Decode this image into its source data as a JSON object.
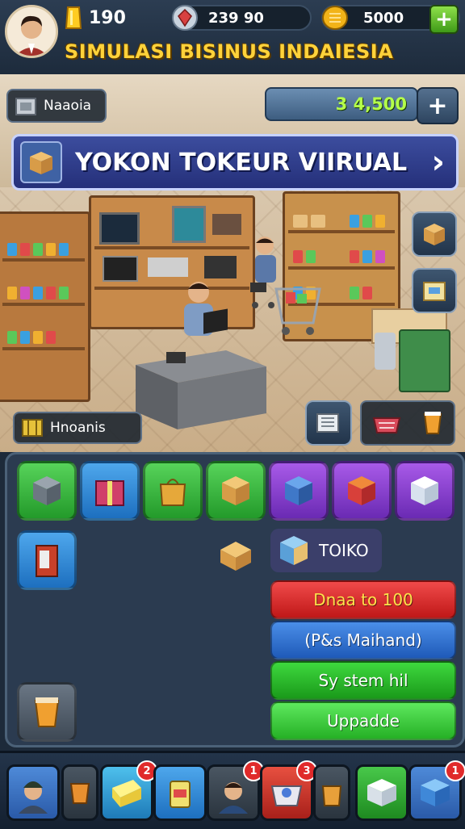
{
  "header": {
    "energy": "190",
    "gems": "239 90",
    "coins": "5000",
    "add_label": "+",
    "title": "SIMULASI BISINUS INDAIESIA"
  },
  "scene": {
    "location_label": "Naaoia",
    "balance": "3 4,500",
    "add_label": "+",
    "banner_title": "YOKON TOKEUR VIIRUAL",
    "banner_arrow": "›",
    "storage_label": "Hnoanis"
  },
  "panel": {
    "shop_name": "TOIKO",
    "buttons": [
      {
        "label": "Dnaa to 100",
        "color": "#e52a2a"
      },
      {
        "label": "(P&s Maihand)",
        "color": "#2a73d6"
      },
      {
        "label": "Sy stem hil",
        "color": "#27b52a"
      },
      {
        "label": "Uppadde",
        "color": "#33c43a"
      }
    ]
  },
  "bottombar": {
    "badges": [
      "2",
      "1",
      "3",
      "1"
    ]
  },
  "colors": {
    "gold": "#ffd23a",
    "green_accent": "#5ac43a"
  }
}
